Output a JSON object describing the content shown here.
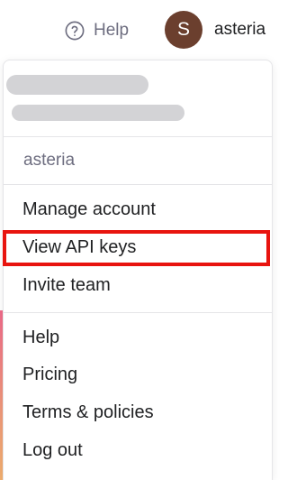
{
  "header": {
    "help_label": "Help",
    "help_icon": "question-circle-icon",
    "avatar_initial": "S",
    "avatar_color": "#6b3f2e",
    "user_name": "asteria"
  },
  "menu": {
    "org_name": "asteria",
    "account_items": [
      {
        "label": "Manage account"
      },
      {
        "label": "View API keys"
      },
      {
        "label": "Invite team"
      }
    ],
    "general_items": [
      {
        "label": "Help"
      },
      {
        "label": "Pricing"
      },
      {
        "label": "Terms & policies"
      },
      {
        "label": "Log out"
      }
    ]
  },
  "highlight": {
    "target": "View API keys",
    "color": "#e8140f"
  }
}
